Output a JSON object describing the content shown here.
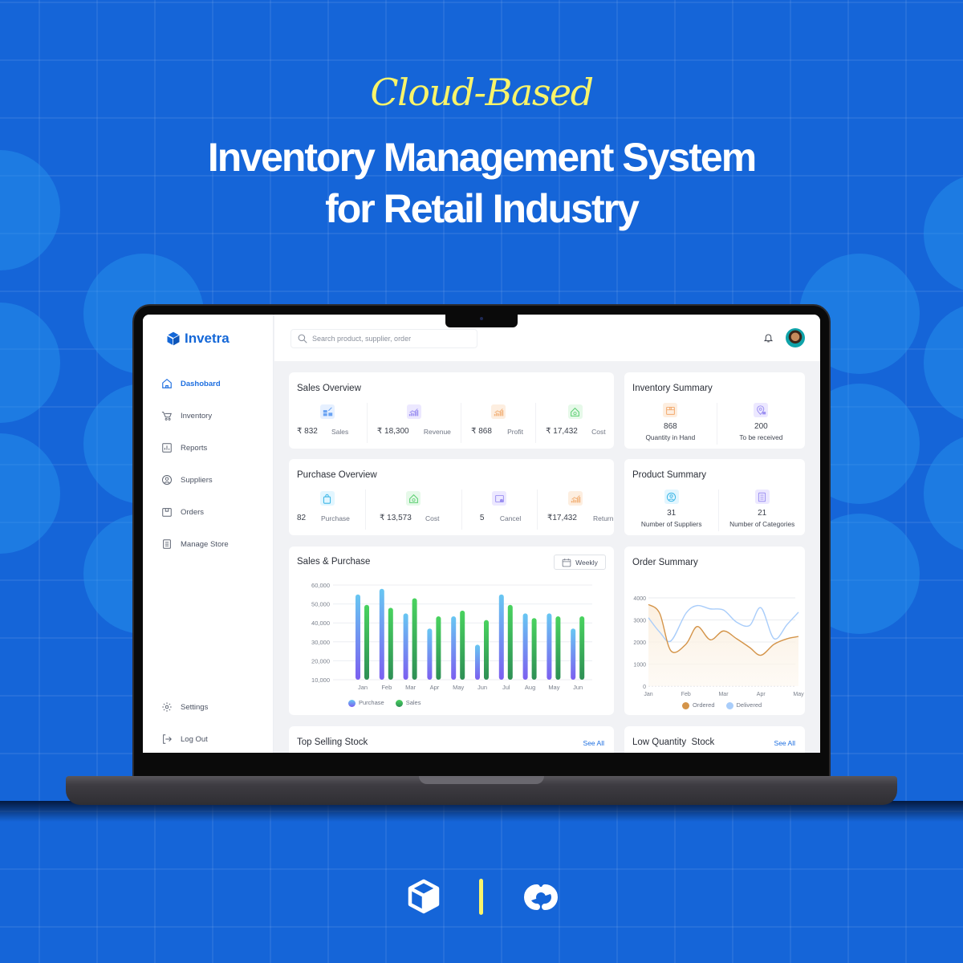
{
  "hero": {
    "subtitle": "Cloud-Based",
    "title_line1": "Inventory Management System",
    "title_line2": "for Retail Industry"
  },
  "app": {
    "name": "Invetra",
    "brand_color": "#1467d7"
  },
  "sidebar": {
    "items": [
      {
        "label": "Dashobard",
        "icon": "home-icon",
        "active": true
      },
      {
        "label": "Inventory",
        "icon": "cart-icon"
      },
      {
        "label": "Reports",
        "icon": "report-icon"
      },
      {
        "label": "Suppliers",
        "icon": "user-circle-icon"
      },
      {
        "label": "Orders",
        "icon": "orders-icon"
      },
      {
        "label": "Manage Store",
        "icon": "store-list-icon"
      }
    ],
    "bottom": [
      {
        "label": "Settings",
        "icon": "gear-icon"
      },
      {
        "label": "Log Out",
        "icon": "logout-icon"
      }
    ]
  },
  "topbar": {
    "search_placeholder": "Search product, supplier, order"
  },
  "sales_overview": {
    "title": "Sales Overview",
    "stats": [
      {
        "value": "₹ 832",
        "label": "Sales"
      },
      {
        "value": "₹ 18,300",
        "label": "Revenue"
      },
      {
        "value": "₹ 868",
        "label": "Profit"
      },
      {
        "value": "₹ 17,432",
        "label": "Cost"
      }
    ]
  },
  "purchase_overview": {
    "title": "Purchase Overview",
    "stats": [
      {
        "value": "82",
        "label": "Purchase"
      },
      {
        "value": "₹ 13,573",
        "label": "Cost"
      },
      {
        "value": "5",
        "label": "Cancel"
      },
      {
        "value": "₹17,432",
        "label": "Return"
      }
    ]
  },
  "inventory_summary": {
    "title": "Inventory Summary",
    "items": [
      {
        "value": "868",
        "label": "Quantity in Hand"
      },
      {
        "value": "200",
        "label": "To be received"
      }
    ]
  },
  "product_summary": {
    "title": "Product Summary",
    "items": [
      {
        "value": "31",
        "label": "Number of Suppliers"
      },
      {
        "value": "21",
        "label": "Number of Categories"
      }
    ]
  },
  "sales_purchase": {
    "title": "Sales & Purchase",
    "filter_label": "Weekly"
  },
  "order_summary": {
    "title": "Order Summary"
  },
  "top_selling": {
    "title": "Top Selling Stock",
    "link": "See All"
  },
  "low_quantity": {
    "title": "Low Quantity  Stock",
    "link": "See All"
  },
  "chart_data": [
    {
      "type": "bar",
      "title": "Sales & Purchase",
      "categories": [
        "Jan",
        "Feb",
        "Mar",
        "Apr",
        "May",
        "Jun",
        "Jul",
        "Aug",
        "May",
        "Jun"
      ],
      "series": [
        {
          "name": "Purchase",
          "color": "#5aa8f0",
          "values": [
            55000,
            58000,
            45000,
            37000,
            43500,
            28500,
            55000,
            45000,
            45000,
            37000
          ]
        },
        {
          "name": "Sales",
          "color": "#3ec95a",
          "values": [
            49500,
            48000,
            53000,
            43500,
            46500,
            41500,
            49500,
            42500,
            43500,
            43500
          ]
        }
      ],
      "yticks": [
        "60,000",
        "50,000",
        "40,000",
        "30,000",
        "20,000",
        "10,000"
      ],
      "ylim": [
        10000,
        60000
      ],
      "legend": "bottom-left",
      "grid": true
    },
    {
      "type": "line",
      "title": "Order Summary",
      "categories": [
        "Jan",
        "Feb",
        "Mar",
        "Apr",
        "May"
      ],
      "x": [
        0,
        0.3,
        0.6,
        1,
        1.3,
        1.65,
        2,
        2.35,
        2.7,
        3,
        3.35,
        3.7,
        4
      ],
      "series": [
        {
          "name": "Ordered",
          "color": "#d49449",
          "values": [
            3700,
            3300,
            1600,
            1900,
            2700,
            2100,
            2500,
            2150,
            1750,
            1400,
            1900,
            2150,
            2250
          ]
        },
        {
          "name": "Delivered",
          "color": "#a9cdfa",
          "values": [
            3100,
            2450,
            2050,
            3300,
            3650,
            3500,
            3450,
            2900,
            2750,
            3550,
            2150,
            2800,
            3350
          ]
        }
      ],
      "yticks": [
        "4000",
        "3000",
        "2000",
        "1000",
        "0"
      ],
      "ylim": [
        0,
        4000
      ],
      "legend": "bottom-center",
      "grid": true
    }
  ]
}
